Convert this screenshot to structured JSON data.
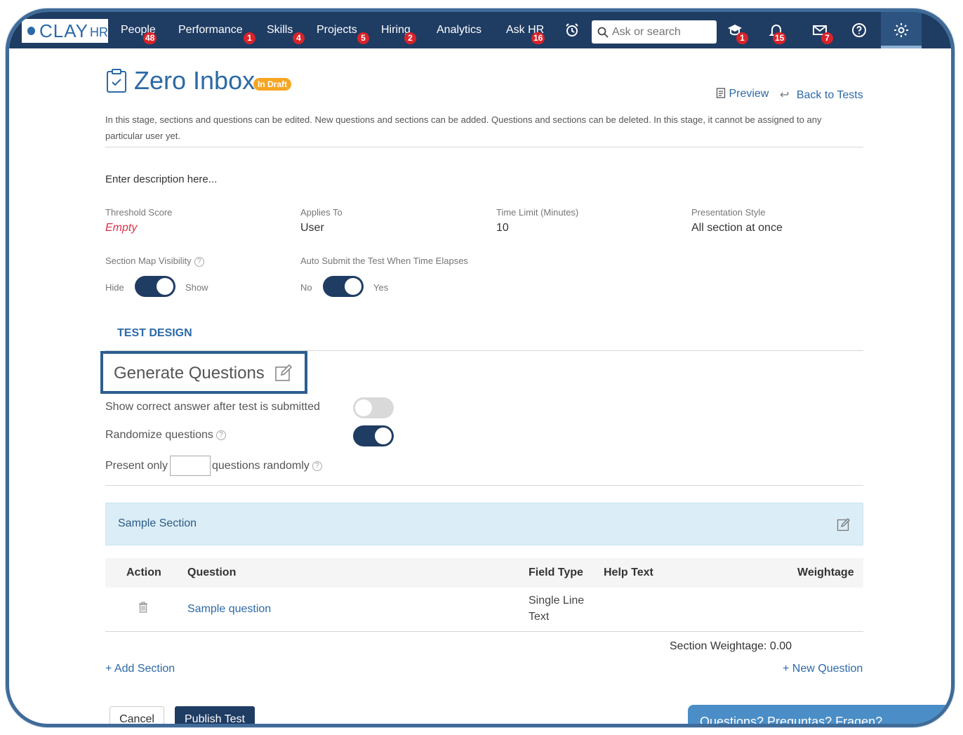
{
  "app": {
    "logo_text": "CLAY",
    "logo_suffix": "HR"
  },
  "nav": {
    "items": [
      {
        "label": "People",
        "badge": "48"
      },
      {
        "label": "Performance",
        "badge": "1"
      },
      {
        "label": "Skills",
        "badge": "4"
      },
      {
        "label": "Projects",
        "badge": "5"
      },
      {
        "label": "Hiring",
        "badge": "2"
      },
      {
        "label": "Analytics",
        "badge": ""
      },
      {
        "label": "Ask HR",
        "badge": "16"
      }
    ],
    "search_placeholder": "Ask or search",
    "icon_badges": {
      "learning": "1",
      "notifications": "15",
      "messages": "7"
    }
  },
  "page": {
    "title": "Zero Inbox",
    "status_badge": "In Draft",
    "preview_label": "Preview",
    "back_label": "Back to Tests",
    "stage_note": "In this stage, sections and questions can be edited. New questions and sections can be added. Questions and sections can be deleted. In this stage, it cannot be assigned to any particular user yet.",
    "description": "Enter description here..."
  },
  "fields": {
    "threshold": {
      "label": "Threshold Score",
      "value": "Empty"
    },
    "applies_to": {
      "label": "Applies To",
      "value": "User"
    },
    "time_limit": {
      "label": "Time Limit (Minutes)",
      "value": "10"
    },
    "presentation": {
      "label": "Presentation Style",
      "value": "All section at once"
    },
    "section_map": {
      "label": "Section Map Visibility",
      "off_label": "Hide",
      "on_label": "Show",
      "on": true
    },
    "auto_submit": {
      "label": "Auto Submit the Test When Time Elapses",
      "off_label": "No",
      "on_label": "Yes",
      "on": true
    }
  },
  "design": {
    "tab_label": "TEST DESIGN",
    "generate_label": "Generate Questions",
    "show_correct_label": "Show correct answer after test is submitted",
    "show_correct_on": false,
    "randomize_label": "Randomize questions",
    "randomize_on": true,
    "present_only_label": "Present only",
    "present_only_value": "",
    "questions_randomly_label": "questions randomly"
  },
  "section": {
    "name": "Sample Section",
    "columns": [
      "Action",
      "Question",
      "Field Type",
      "Help Text",
      "Weightage"
    ],
    "rows": [
      {
        "question": "Sample question",
        "field_type_line1": "Single Line",
        "field_type_line2": "Text",
        "help_text": "",
        "weightage": ""
      }
    ],
    "weightage_summary": "Section Weightage: 0.00"
  },
  "actions": {
    "add_section": "+ Add Section",
    "new_question": "+ New Question",
    "cancel": "Cancel",
    "publish": "Publish Test"
  },
  "help_widget": {
    "label": "Questions? Preguntas? Fragen?"
  },
  "colors": {
    "nav_bg": "#1f3c63",
    "accent": "#2c6aa6",
    "badge": "#d8232a",
    "draft": "#f6a623",
    "section_bg": "#dbedf6"
  }
}
